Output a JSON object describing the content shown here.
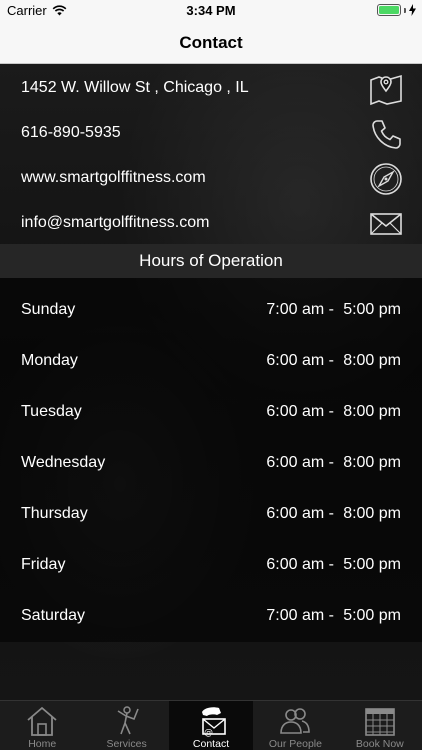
{
  "status_bar": {
    "carrier": "Carrier",
    "time": "3:34 PM"
  },
  "nav": {
    "title": "Contact"
  },
  "contact": {
    "address": "1452 W. Willow St , Chicago , IL",
    "phone": "616-890-5935",
    "website": "www.smartgolffitness.com",
    "email": "info@smartgolffitness.com"
  },
  "hours": {
    "title": "Hours of Operation",
    "days": [
      {
        "day": "Sunday",
        "open": "7:00 am -",
        "close": "5:00 pm"
      },
      {
        "day": "Monday",
        "open": "6:00 am -",
        "close": "8:00 pm"
      },
      {
        "day": "Tuesday",
        "open": "6:00 am -",
        "close": "8:00 pm"
      },
      {
        "day": "Wednesday",
        "open": "6:00 am -",
        "close": "8:00 pm"
      },
      {
        "day": "Thursday",
        "open": "6:00 am -",
        "close": "8:00 pm"
      },
      {
        "day": "Friday",
        "open": "6:00 am -",
        "close": "5:00 pm"
      },
      {
        "day": "Saturday",
        "open": "7:00 am -",
        "close": "5:00 pm"
      }
    ]
  },
  "tabs": [
    {
      "label": "Home",
      "icon": "home-icon"
    },
    {
      "label": "Services",
      "icon": "golfer-icon"
    },
    {
      "label": "Contact",
      "icon": "phone-mail-icon",
      "active": true
    },
    {
      "label": "Our People",
      "icon": "people-icon"
    },
    {
      "label": "Book Now",
      "icon": "calendar-icon"
    }
  ],
  "colors": {
    "battery": "#4cd964",
    "bar_bg": "#f7f7f7",
    "tab_bg": "#1c1c1c"
  }
}
